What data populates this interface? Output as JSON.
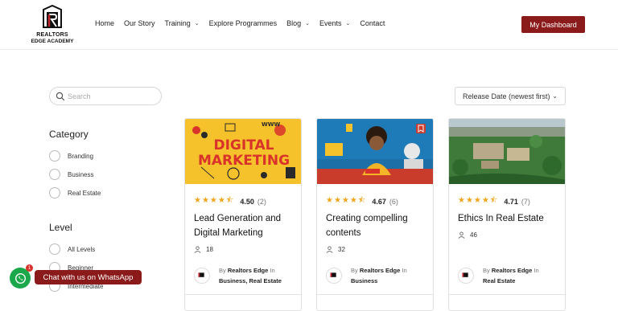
{
  "header": {
    "logo_line1": "REALTORS",
    "logo_line2": "EDGE ACADEMY",
    "nav": [
      {
        "label": "Home",
        "has_dropdown": false
      },
      {
        "label": "Our Story",
        "has_dropdown": false
      },
      {
        "label": "Training",
        "has_dropdown": true
      },
      {
        "label": "Explore Programmes",
        "has_dropdown": false
      },
      {
        "label": "Blog",
        "has_dropdown": true
      },
      {
        "label": "Events",
        "has_dropdown": true
      },
      {
        "label": "Contact",
        "has_dropdown": false
      }
    ],
    "dashboard_button": "My Dashboard",
    "accent_color": "#8b1a1a"
  },
  "sidebar": {
    "search_placeholder": "Search",
    "category_heading": "Category",
    "categories": [
      "Branding",
      "Business",
      "Real Estate"
    ],
    "level_heading": "Level",
    "levels": [
      "All Levels",
      "Beginner",
      "Intermediate"
    ]
  },
  "sort": {
    "selected": "Release Date (newest first)"
  },
  "courses": [
    {
      "image_text": "DIGITAL MARKETING",
      "image_www": "WWW",
      "rating": "4.50",
      "reviews": "(2)",
      "title": "Lead Generation and Digital Marketing",
      "students": "18",
      "by": "By",
      "author": "Realtors Edge",
      "in": "In",
      "categories": "Business, Real Estate"
    },
    {
      "rating": "4.67",
      "reviews": "(6)",
      "title": "Creating compelling contents",
      "students": "32",
      "by": "By",
      "author": "Realtors Edge",
      "in": "In",
      "categories": "Business"
    },
    {
      "rating": "4.71",
      "reviews": "(7)",
      "title": "Ethics In Real Estate",
      "students": "46",
      "by": "By",
      "author": "Realtors Edge",
      "in": "In",
      "categories": "Real Estate"
    }
  ],
  "whatsapp": {
    "label": "Chat with us on WhatsApp",
    "badge": "1",
    "color": "#1aa84a"
  }
}
